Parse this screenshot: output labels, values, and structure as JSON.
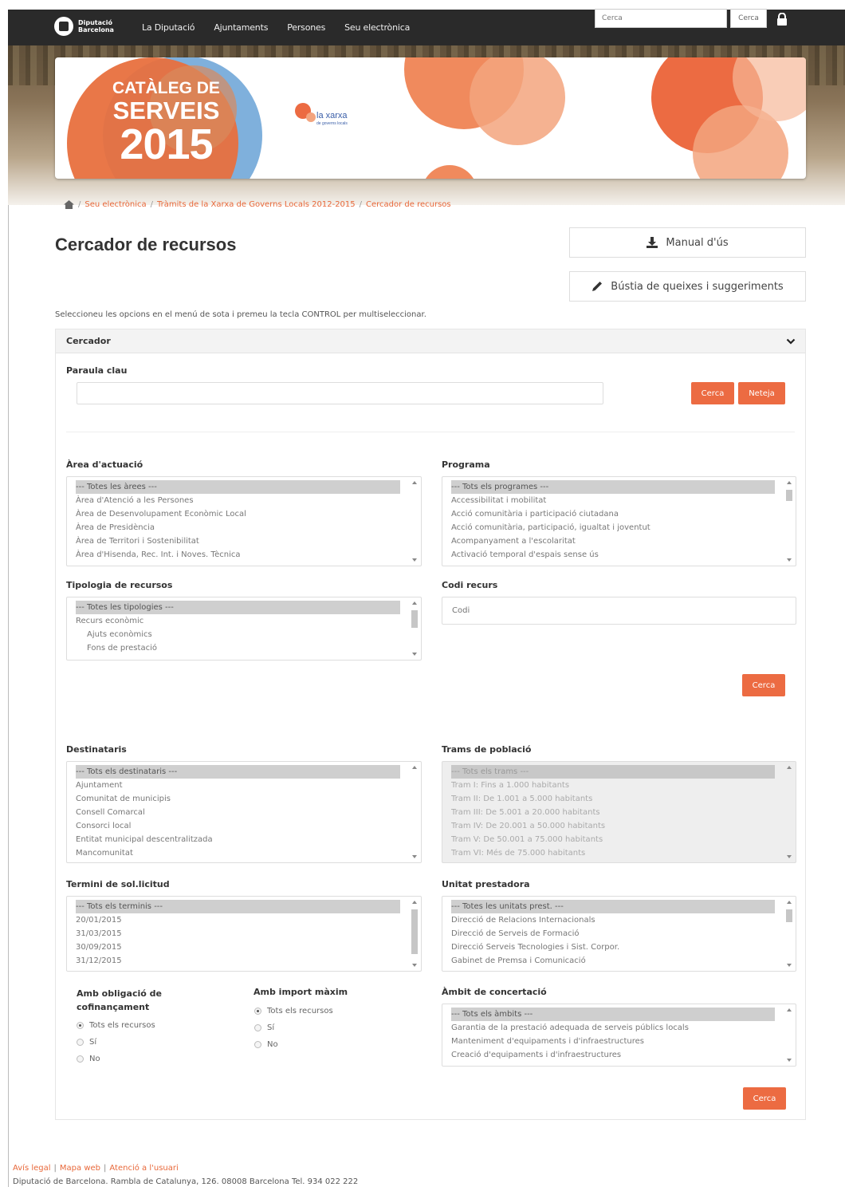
{
  "navbar": {
    "logo_line1": "Diputació",
    "logo_line2": "Barcelona",
    "items": [
      "La Diputació",
      "Ajuntaments",
      "Persones",
      "Seu electrònica"
    ],
    "search_placeholder": "Cerca",
    "search_button": "Cerca"
  },
  "hero": {
    "title_line1": "CATÀLEG DE",
    "title_line2": "SERVEIS",
    "title_line3": "2015",
    "xarxa_label": "la xarxa",
    "xarxa_sub": "de governs locals"
  },
  "breadcrumb": [
    "Seu electrònica",
    "Tràmits de la Xarxa de Governs Locals 2012-2015",
    "Cercador de recursos"
  ],
  "page": {
    "title": "Cercador de recursos",
    "manual_button": "Manual d'ús",
    "complaints_button": "Bústia de queixes i suggeriments",
    "instructions": "Seleccioneu les opcions en el menú de sota i premeu la tecla CONTROL per multiseleccionar."
  },
  "panel": {
    "title": "Cercador",
    "keyword": {
      "label": "Paraula clau",
      "value": "",
      "search_button": "Cerca",
      "clear_button": "Neteja"
    },
    "area": {
      "label": "Àrea d'actuació",
      "options": [
        "--- Totes les àrees ---",
        "Àrea d'Atenció a les Persones",
        "Àrea de Desenvolupament Econòmic Local",
        "Àrea de Presidència",
        "Àrea de Territori i Sostenibilitat",
        "Àrea d'Hisenda, Rec. Int. i Noves. Tècnica"
      ]
    },
    "programa": {
      "label": "Programa",
      "options": [
        "--- Tots els programes ---",
        "Accessibilitat i mobilitat",
        "Acció comunitària i participació ciutadana",
        "Acció comunitària, participació, igualtat i joventut",
        "Acompanyament a l'escolaritat",
        "Activació temporal d'espais sense ús"
      ]
    },
    "tipologia": {
      "label": "Tipologia de recursos",
      "options": [
        "--- Totes les tipologies ---",
        "Recurs econòmic",
        "Ajuts econòmics",
        "Fons de prestació"
      ]
    },
    "codi": {
      "label": "Codi recurs",
      "placeholder": "Codi"
    },
    "search_button_mid": "Cerca",
    "destinataris": {
      "label": "Destinataris",
      "options": [
        "--- Tots els destinataris ---",
        "Ajuntament",
        "Comunitat de municipis",
        "Consell Comarcal",
        "Consorci local",
        "Entitat municipal descentralitzada",
        "Mancomunitat"
      ]
    },
    "trams": {
      "label": "Trams de població",
      "options": [
        "--- Tots els trams ---",
        "Tram I: Fins a 1.000 habitants",
        "Tram II: De 1.001 a 5.000 habitants",
        "Tram III: De 5.001 a 20.000 habitants",
        "Tram IV: De 20.001 a 50.000 habitants",
        "Tram V: De 50.001 a 75.000 habitants",
        "Tram VI: Més de 75.000 habitants"
      ]
    },
    "termini": {
      "label": "Termini de sol.licitud",
      "options": [
        "--- Tots els terminis ---",
        "20/01/2015",
        "31/03/2015",
        "30/09/2015",
        "31/12/2015"
      ]
    },
    "unitat": {
      "label": "Unitat prestadora",
      "options": [
        "--- Totes les unitats prest. ---",
        "Direcció de Relacions Internacionals",
        "Direcció de Serveis de Formació",
        "Direcció Serveis Tecnologies i Sist. Corpor.",
        "Gabinet de Premsa i Comunicació"
      ]
    },
    "cofinancament": {
      "label_line1": "Amb obligació de",
      "label_line2": "cofinançament",
      "options": [
        "Tots els recursos",
        "Sí",
        "No"
      ]
    },
    "import": {
      "label": "Amb import màxim",
      "options": [
        "Tots els recursos",
        "Sí",
        "No"
      ]
    },
    "ambit": {
      "label": "Àmbit de concertació",
      "options": [
        "--- Tots els àmbits ---",
        "Garantia de la prestació adequada de serveis públics locals",
        "Manteniment d'equipaments i d'infraestructures",
        "Creació d'equipaments i d'infraestructures"
      ]
    },
    "search_button_bottom": "Cerca"
  },
  "footer": {
    "links": [
      "Avís legal",
      "Mapa web",
      "Atenció a l'usuari"
    ],
    "address": "Diputació de Barcelona. Rambla de Catalunya, 126. 08008 Barcelona Tel. 934 022 222"
  },
  "colors": {
    "accent": "#ec6b42",
    "navbar": "#2a2a2a"
  }
}
